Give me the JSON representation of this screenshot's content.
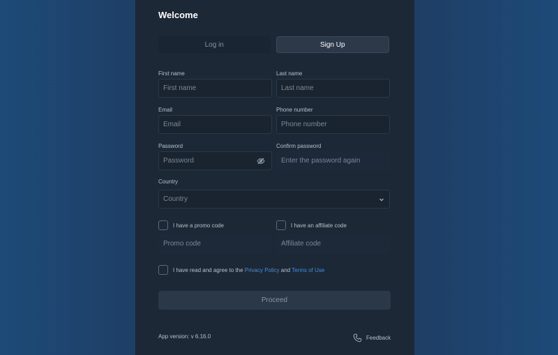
{
  "header": {
    "title": "Welcome"
  },
  "tabs": [
    {
      "label": "Log in",
      "active": false
    },
    {
      "label": "Sign Up",
      "active": true
    }
  ],
  "form": {
    "first_name": {
      "label": "First name",
      "placeholder": "First name"
    },
    "last_name": {
      "label": "Last name",
      "placeholder": "Last name"
    },
    "email": {
      "label": "Email",
      "placeholder": "Email"
    },
    "phone": {
      "label": "Phone number",
      "placeholder": "Phone number"
    },
    "password": {
      "label": "Password",
      "placeholder": "Password"
    },
    "confirm_password": {
      "label": "Confirm password",
      "placeholder": "Enter the password again"
    },
    "country": {
      "label": "Country",
      "placeholder": "Country"
    },
    "promo": {
      "checkbox_label": "I have a promo code",
      "placeholder": "Promo code",
      "checked": false
    },
    "affiliate": {
      "checkbox_label": "I have an affiliate code",
      "placeholder": "Affiliate code",
      "checked": false
    },
    "agreement": {
      "prefix": "I have read and agree to the ",
      "privacy_link": "Privacy Policy",
      "conjunction": " and ",
      "terms_link": "Terms of Use",
      "checked": false
    },
    "submit_label": "Proceed"
  },
  "footer": {
    "version": "App version: v 6.16.0",
    "feedback_label": "Feedback"
  },
  "colors": {
    "panel": "#1c2836",
    "link": "#3d8fe0",
    "background_edge": "#1d4a78"
  },
  "icons": [
    "eye-off-icon",
    "chevron-down-icon",
    "phone-icon"
  ]
}
